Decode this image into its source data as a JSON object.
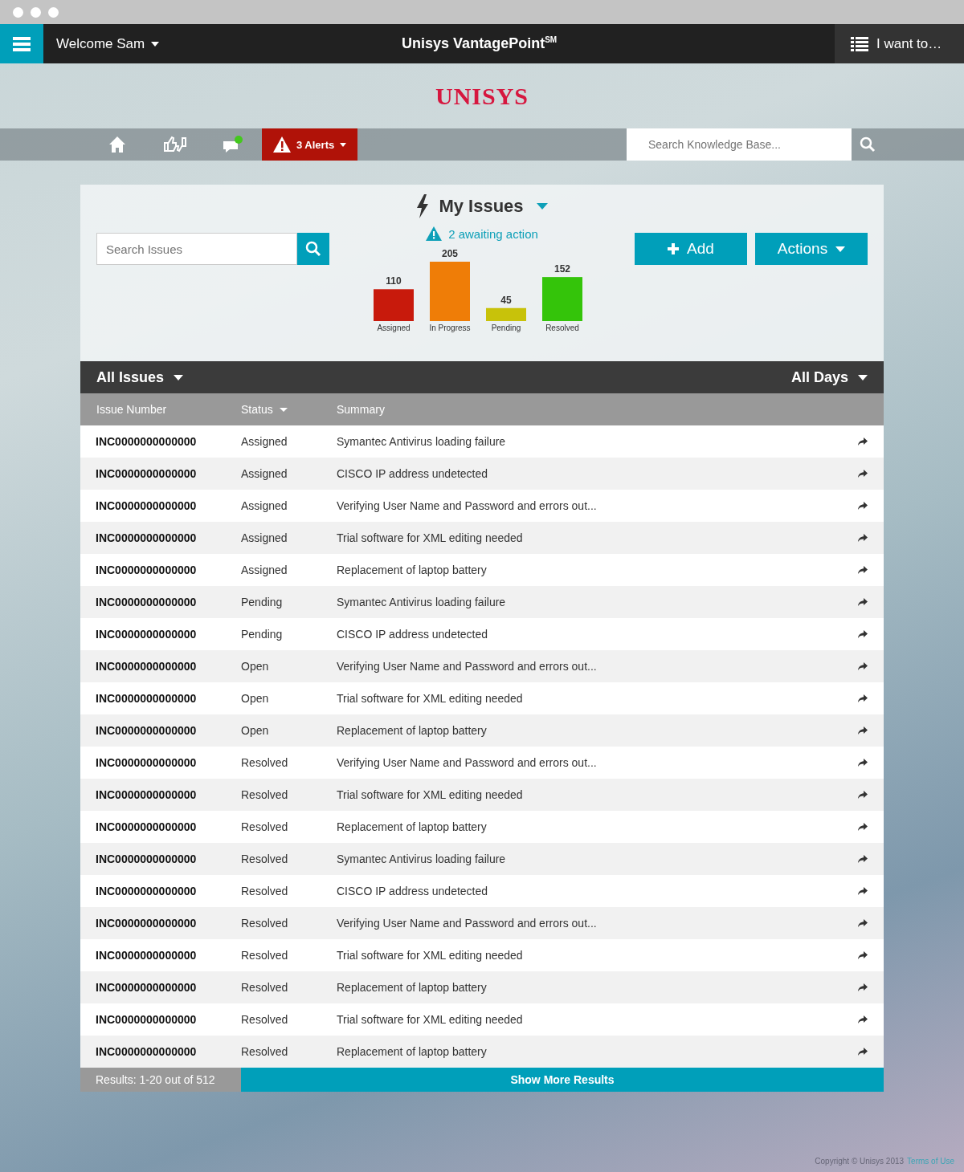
{
  "header": {
    "welcome": "Welcome Sam",
    "title": "Unisys VantagePoint$^{SM}$",
    "menu": "I want to…"
  },
  "logo": "UNISYS",
  "nav": {
    "messages_unread": true,
    "alerts": "3 Alerts",
    "search_placeholder": "Search Knowledge Base..."
  },
  "panel": {
    "title": "My Issues",
    "awaiting": "2 awaiting action",
    "search_placeholder": "Search Issues",
    "add_button": "Add",
    "actions_button": "Actions",
    "chart_data": {
      "type": "bar",
      "categories": [
        "Assigned",
        "In Progress",
        "Pending",
        "Resolved"
      ],
      "values": [
        110,
        205,
        45,
        152
      ],
      "data_labels": true
    }
  },
  "table": {
    "filter": "All Issues",
    "range": "All Days",
    "columns": [
      {
        "label": "Issue Number",
        "menu": false
      },
      {
        "label": "Status",
        "menu": true
      },
      {
        "label": "Summary",
        "menu": false
      }
    ],
    "rows": [
      {
        "issue": "INC0000000000000",
        "status": "Assigned",
        "summary": "Symantec Antivirus loading failure"
      },
      {
        "issue": "INC0000000000000",
        "status": "Assigned",
        "summary": "CISCO IP address undetected"
      },
      {
        "issue": "INC0000000000000",
        "status": "Assigned",
        "summary": "Verifying User Name and Password and errors out..."
      },
      {
        "issue": "INC0000000000000",
        "status": "Assigned",
        "summary": "Trial software for XML editing needed"
      },
      {
        "issue": "INC0000000000000",
        "status": "Assigned",
        "summary": "Replacement of laptop battery"
      },
      {
        "issue": "INC0000000000000",
        "status": "Pending",
        "summary": "Symantec Antivirus loading failure"
      },
      {
        "issue": "INC0000000000000",
        "status": "Pending",
        "summary": "CISCO IP address undetected"
      },
      {
        "issue": "INC0000000000000",
        "status": "Open",
        "summary": "Verifying User Name and Password and errors out..."
      },
      {
        "issue": "INC0000000000000",
        "status": "Open",
        "summary": "Trial software for XML editing needed"
      },
      {
        "issue": "INC0000000000000",
        "status": "Open",
        "summary": "Replacement of laptop battery"
      },
      {
        "issue": "INC0000000000000",
        "status": "Resolved",
        "summary": "Verifying User Name and Password and errors out..."
      },
      {
        "issue": "INC0000000000000",
        "status": "Resolved",
        "summary": "Trial software for XML editing needed"
      },
      {
        "issue": "INC0000000000000",
        "status": "Resolved",
        "summary": "Replacement of laptop battery"
      },
      {
        "issue": "INC0000000000000",
        "status": "Resolved",
        "summary": "Symantec Antivirus loading failure"
      },
      {
        "issue": "INC0000000000000",
        "status": "Resolved",
        "summary": "CISCO IP address undetected"
      },
      {
        "issue": "INC0000000000000",
        "status": "Resolved",
        "summary": "Verifying User Name and Password and errors out..."
      },
      {
        "issue": "INC0000000000000",
        "status": "Resolved",
        "summary": "Trial software for XML editing needed"
      },
      {
        "issue": "INC0000000000000",
        "status": "Resolved",
        "summary": "Replacement of laptop battery"
      },
      {
        "issue": "INC0000000000000",
        "status": "Resolved",
        "summary": "Trial software for XML editing needed"
      },
      {
        "issue": "INC0000000000000",
        "status": "Resolved",
        "summary": "Replacement of laptop battery"
      }
    ],
    "results": "Results: 1-20 out of 512",
    "show_more": "Show More Results"
  },
  "footer": {
    "copyright": "Copyright © Unisys 2013",
    "terms": "Terms of Use"
  }
}
